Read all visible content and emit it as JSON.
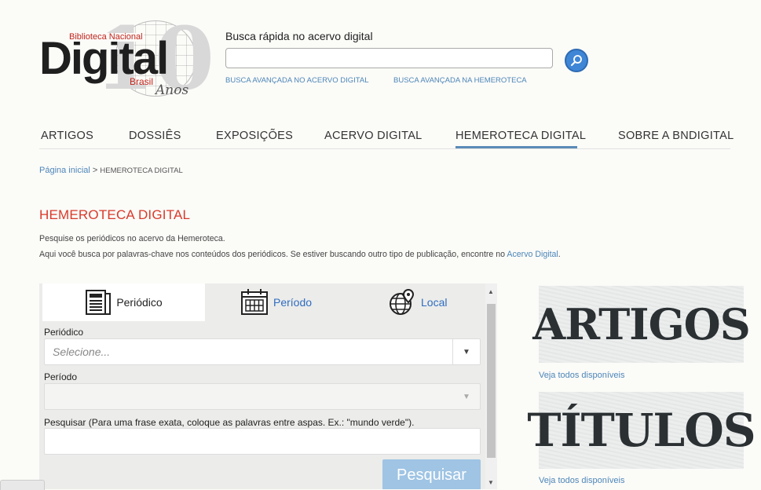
{
  "logo": {
    "institution": "Biblioteca Nacional",
    "name": "Digital",
    "country": "Brasil",
    "anniversary_number": "10",
    "anniversary_word": "Anos"
  },
  "search": {
    "label": "Busca rápida no acervo digital",
    "value": "",
    "icon": "magnifier-icon",
    "advanced_links": [
      "BUSCA AVANÇADA NO ACERVO DIGITAL",
      "BUSCA AVANÇADA NA HEMEROTECA"
    ]
  },
  "nav": {
    "items": [
      "ARTIGOS",
      "DOSSIÊS",
      "EXPOSIÇÕES",
      "ACERVO DIGITAL",
      "HEMEROTECA DIGITAL",
      "SOBRE A BNDIGITAL"
    ],
    "active": "HEMEROTECA DIGITAL",
    "accent_color": "#5a8bb8"
  },
  "breadcrumb": {
    "home": "Página inicial",
    "separator": " > ",
    "current": "HEMEROTECA DIGITAL"
  },
  "page": {
    "title": "HEMEROTECA DIGITAL",
    "title_color": "#d93a2b",
    "desc_line1": "Pesquise os periódicos no acervo da Hemeroteca.",
    "desc_line2": "Aqui você busca por palavras-chave nos conteúdos dos periódicos. Se estiver buscando outro tipo de publicação, encontre no ",
    "desc_link": "Acervo Digital",
    "desc_end": "."
  },
  "panel": {
    "tabs": [
      {
        "label": "Periódico",
        "icon": "newspaper-icon"
      },
      {
        "label": "Período",
        "icon": "calendar-icon"
      },
      {
        "label": "Local",
        "icon": "globe-pin-icon"
      }
    ],
    "periodico_label": "Periódico",
    "periodico_placeholder": "Selecione...",
    "periodo_label": "Período",
    "periodo_value": "",
    "pesquisar_label": "Pesquisar (Para uma frase exata, coloque as palavras entre aspas. Ex.: \"mundo verde\").",
    "pesquisar_value": "",
    "submit_label": "Pesquisar"
  },
  "sidebar": {
    "banners": [
      {
        "title": "ARTIGOS",
        "link": "Veja todos disponíveis"
      },
      {
        "title": "TÍTULOS",
        "link": "Veja todos disponíveis"
      }
    ]
  }
}
